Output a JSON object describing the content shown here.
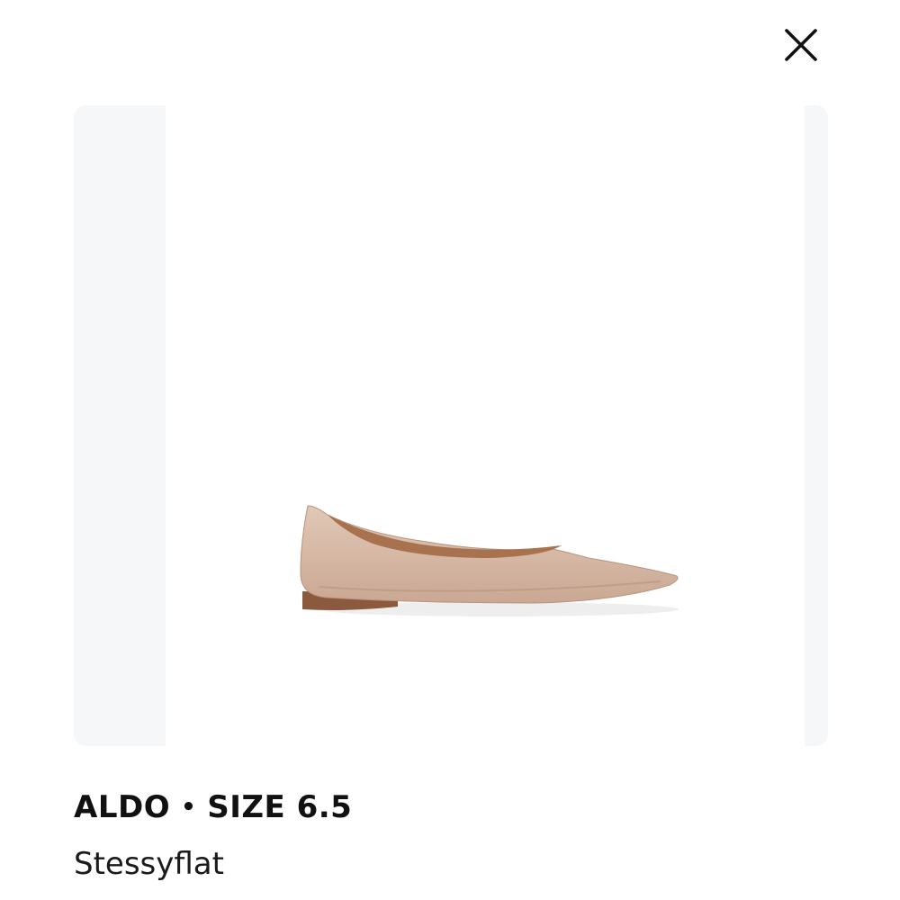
{
  "modal": {
    "close_icon": "close-icon",
    "image_alt": "Stessyflat",
    "brand": "ALDO",
    "separator": "•",
    "size_label": "SIZE 6.5",
    "product_name": "Stessyflat"
  },
  "colors": {
    "panel_background": "#f6f7f9",
    "text": "#111111",
    "shoe_upper": "#d7b9a6",
    "shoe_sole": "#8b5a3e"
  }
}
